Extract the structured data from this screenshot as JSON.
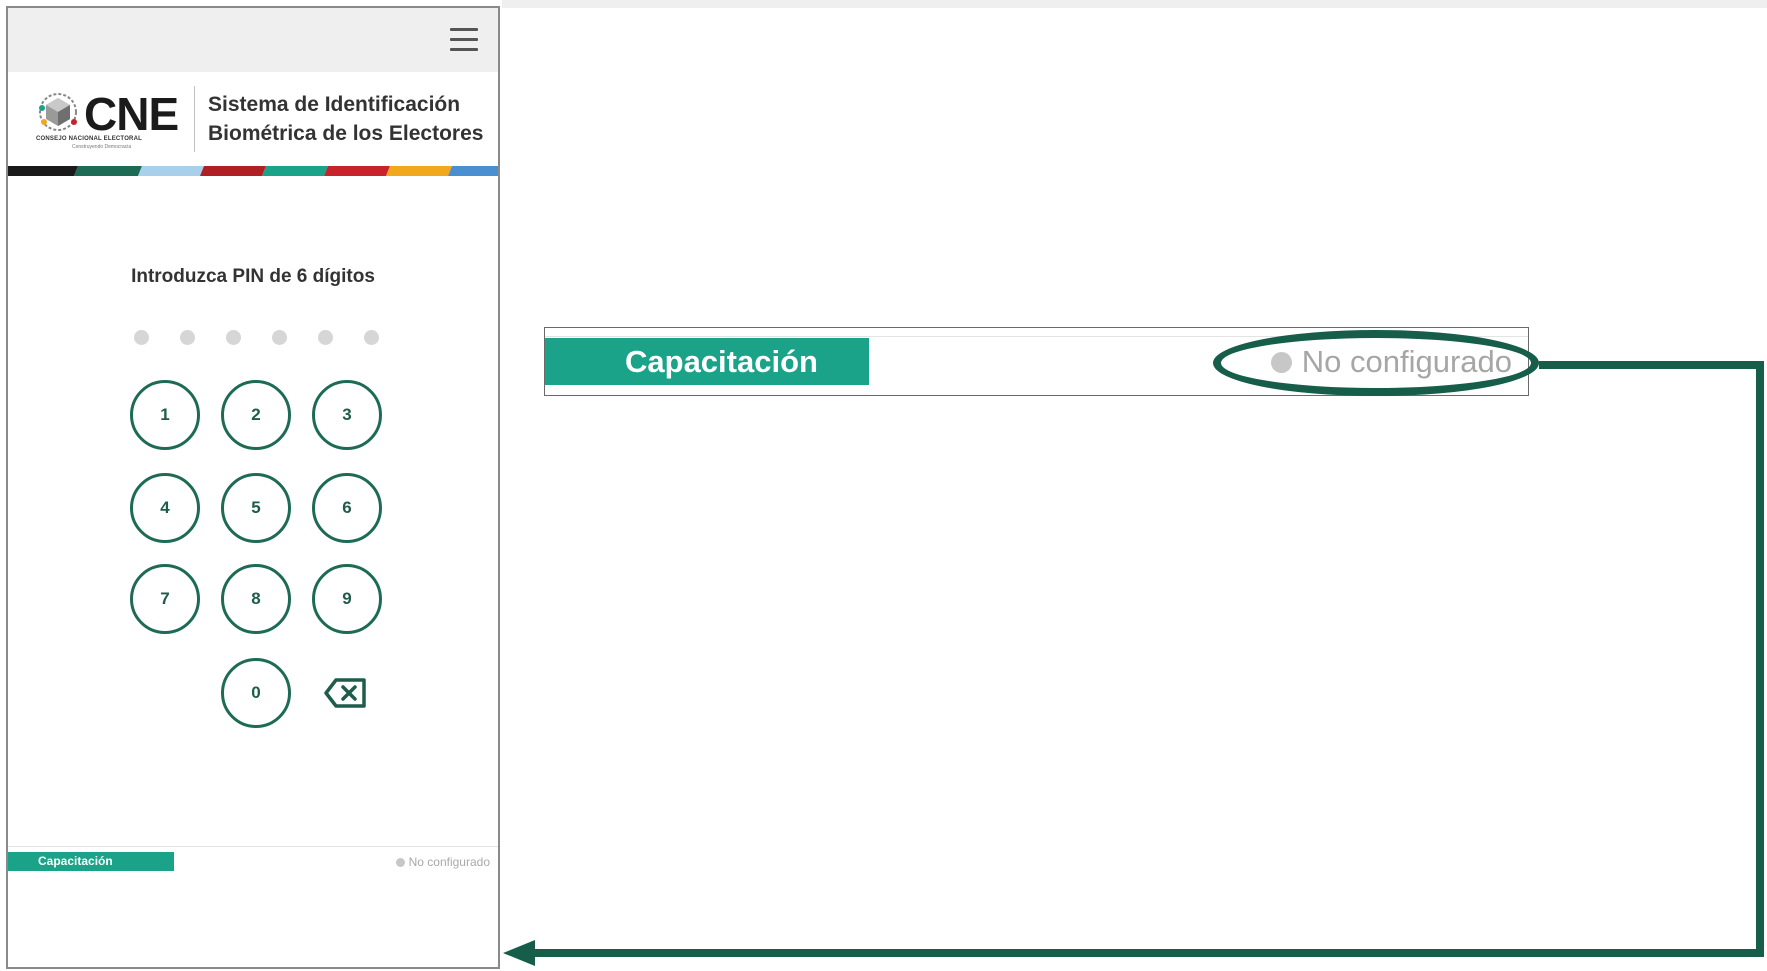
{
  "header": {
    "logo_text": "CNE",
    "logo_subtitle": "CONSEJO NACIONAL ELECTORAL",
    "logo_tagline": "Construyendo Democracia",
    "title_line1": "Sistema de Identificación",
    "title_line2": "Biométrica de los Electores"
  },
  "stripe_colors": [
    "#1a1a1a",
    "#1e6b55",
    "#a8d0ea",
    "#b01f24",
    "#1aa388",
    "#c8222a",
    "#f2a81d",
    "#4a8fcf"
  ],
  "pin": {
    "label": "Introduzca PIN de 6 dígitos",
    "length": 6,
    "filled": 0
  },
  "keypad": {
    "keys": [
      "1",
      "2",
      "3",
      "4",
      "5",
      "6",
      "7",
      "8",
      "9",
      "0"
    ],
    "backspace_icon": "backspace-icon"
  },
  "footer": {
    "mode_label": "Capacitación",
    "status_label": "No configurado"
  },
  "callout": {
    "mode_label": "Capacitación",
    "status_label": "No configurado"
  },
  "colors": {
    "accent_green": "#1aa388",
    "dark_green": "#1e6b55",
    "annotation_green": "#165e4a",
    "status_gray": "#a9a9a9"
  }
}
